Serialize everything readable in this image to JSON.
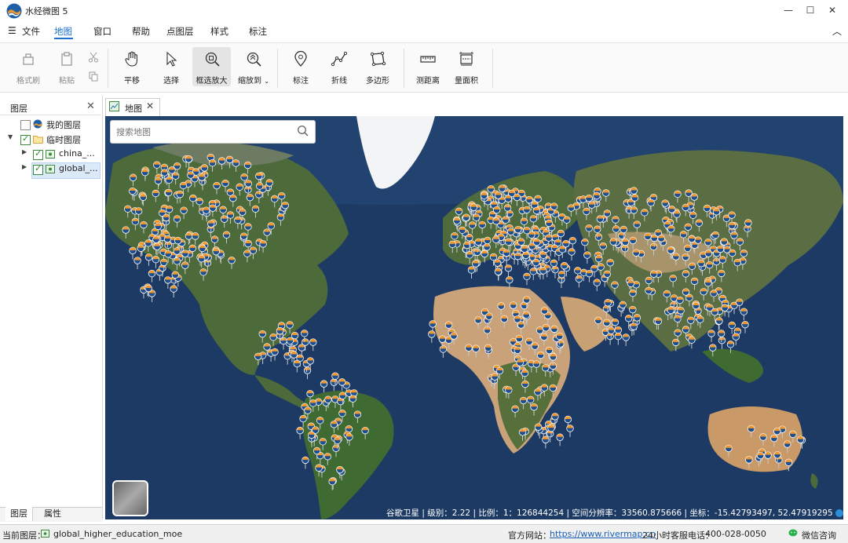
{
  "window": {
    "title": "水经微图 5",
    "controls": {
      "minimize": "—",
      "maximize": "☐",
      "close": "✕"
    }
  },
  "menu": {
    "items": [
      "文件",
      "地图",
      "窗口",
      "帮助",
      "点图层",
      "样式",
      "标注"
    ],
    "active": "地图",
    "collapse_glyph": "︿"
  },
  "ribbon": {
    "format_brush": "格式刷",
    "paste": "粘贴",
    "pan": "平移",
    "select": "选择",
    "box_zoom": "框选放大",
    "zoom_to": "缩放到",
    "marker": "标注",
    "polyline": "折线",
    "polygon": "多边形",
    "measure_distance": "测距离",
    "measure_area": "量面积"
  },
  "layer_panel": {
    "title": "图层",
    "tree": [
      {
        "label": "我的图层",
        "checked": false
      },
      {
        "label": "临时图层",
        "checked": true
      },
      {
        "label": "china_...",
        "checked": true
      },
      {
        "label": "global_...",
        "checked": true
      }
    ],
    "tabs": [
      "图层",
      "属性"
    ]
  },
  "document_tab": {
    "label": "地图"
  },
  "map": {
    "search_placeholder": "搜索地图",
    "source": "谷歌卫星",
    "level_label": "级别：",
    "level": "2.22",
    "scale_label": "比例：",
    "scale": "1：126844254",
    "resolution_label": "空间分辨率：",
    "resolution": "33560.875666",
    "coord_label": "坐标：",
    "coords": "-15.42793497,  52.47919295",
    "colors": {
      "ocean": "#1c3a63",
      "land": "#4d6a3a",
      "desert": "#c9a27a",
      "ice": "#f2f4f6",
      "marker_orange": "#f0962a",
      "marker_blue": "#1f4f8c"
    }
  },
  "statusbar": {
    "current_layer_label": "当前图层：",
    "current_layer": "global_higher_education_moe",
    "website_label": "官方网站：",
    "website": "https://www.rivermap.cn",
    "hotline_label": "24小时客服电话：",
    "hotline": "400-028-0050",
    "wechat": "微信咨询"
  }
}
